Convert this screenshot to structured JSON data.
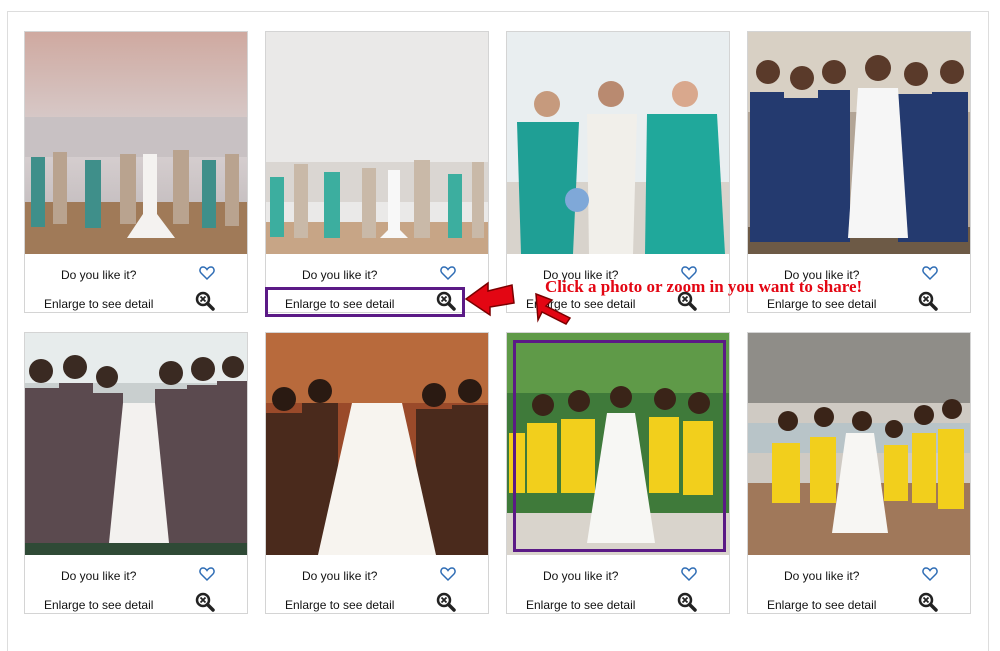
{
  "cards": [
    {
      "like_label": "Do you like it?",
      "enlarge_label": "Enlarge to see detail",
      "photo": "beach-sunset-back-view"
    },
    {
      "like_label": "Do you like it?",
      "enlarge_label": "Enlarge to see detail",
      "photo": "beach-lineup"
    },
    {
      "like_label": "Do you like it?",
      "enlarge_label": "Enlarge to see detail",
      "photo": "teal-bridesmaids-portrait"
    },
    {
      "like_label": "Do you like it?",
      "enlarge_label": "Enlarge to see detail",
      "photo": "navy-bridesmaids-indoor"
    },
    {
      "like_label": "Do you like it?",
      "enlarge_label": "Enlarge to see detail",
      "photo": "mocha-bridesmaids-posing"
    },
    {
      "like_label": "Do you like it?",
      "enlarge_label": "Enlarge to see detail",
      "photo": "brown-bridesmaids-back-view"
    },
    {
      "like_label": "Do you like it?",
      "enlarge_label": "Enlarge to see detail",
      "photo": "yellow-bridesmaids-garden"
    },
    {
      "like_label": "Do you like it?",
      "enlarge_label": "Enlarge to see detail",
      "photo": "yellow-bridesmaids-beach"
    }
  ],
  "callout": {
    "text": "Click a photo or zoom in you want to share!",
    "color": "#e30613"
  },
  "colors": {
    "highlight": "#5b1a86",
    "heart": "#2f6db5",
    "arrow": "#e30613"
  },
  "icons": {
    "like": "heart-outline-icon",
    "zoom": "magnifier-x-icon"
  }
}
